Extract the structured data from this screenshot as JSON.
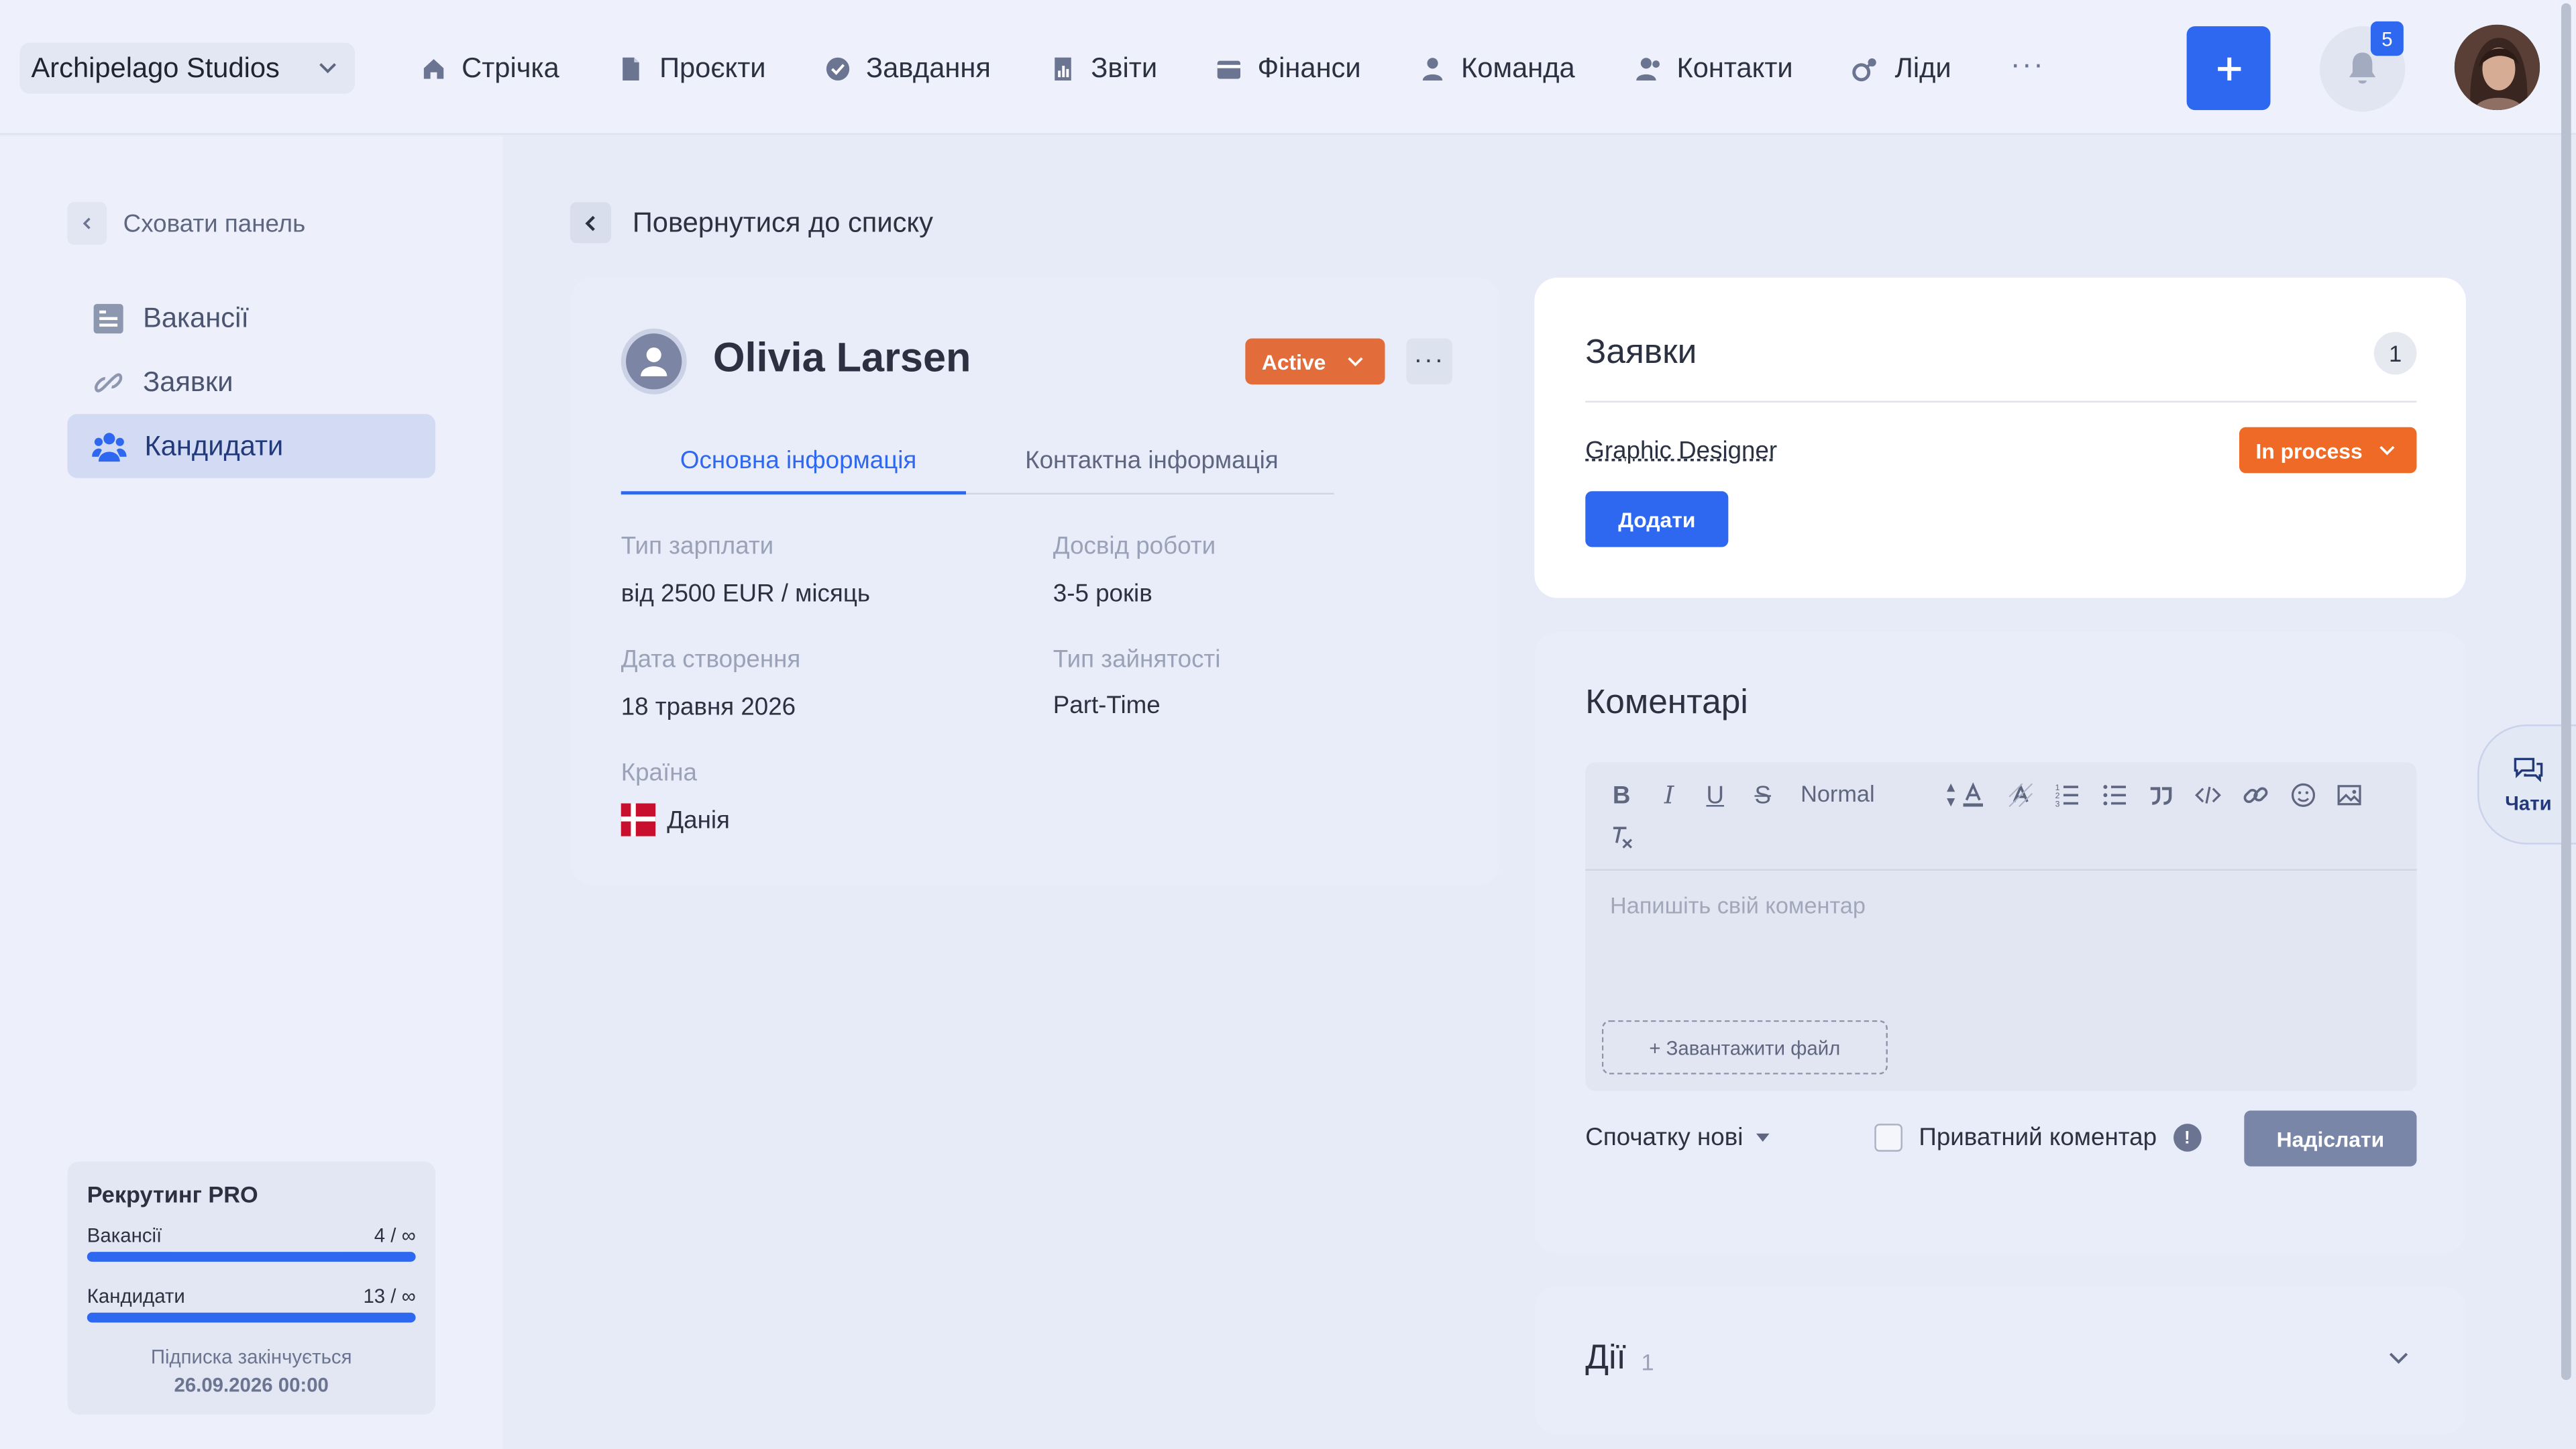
{
  "header": {
    "company": "Archipelago Studios",
    "nav": [
      {
        "label": "Стрічка",
        "icon": "home-icon"
      },
      {
        "label": "Проєкти",
        "icon": "document-icon"
      },
      {
        "label": "Завдання",
        "icon": "check-circle-icon"
      },
      {
        "label": "Звіти",
        "icon": "report-icon"
      },
      {
        "label": "Фінанси",
        "icon": "wallet-icon"
      },
      {
        "label": "Команда",
        "icon": "user-icon"
      },
      {
        "label": "Контакти",
        "icon": "contacts-icon"
      },
      {
        "label": "Ліди",
        "icon": "leads-icon"
      }
    ],
    "more": "···",
    "notifications": "5",
    "accent": "#2f68f0"
  },
  "sidebar": {
    "hide_label": "Сховати панель",
    "items": [
      {
        "label": "Вакансії",
        "icon": "list-icon",
        "active": false
      },
      {
        "label": "Заявки",
        "icon": "link-icon",
        "active": false
      },
      {
        "label": "Кандидати",
        "icon": "people-icon",
        "active": true
      }
    ],
    "plan": {
      "title": "Рекрутинг PRO",
      "rows": [
        {
          "label": "Вакансії",
          "value": "4 / ∞"
        },
        {
          "label": "Кандидати",
          "value": "13 / ∞"
        }
      ],
      "note": "Підписка закінчується",
      "expires": "26.09.2026 00:00"
    }
  },
  "main": {
    "back_label": "Повернутися до списку",
    "profile": {
      "name": "Olivia Larsen",
      "status": "Active",
      "status_color": "#e36c3b",
      "more": "···",
      "tabs": [
        "Основна інформація",
        "Контактна інформація"
      ],
      "active_tab": 0,
      "fields": {
        "salary_label": "Тип зарплати",
        "salary_value": "від 2500 EUR / місяць",
        "experience_label": "Досвід роботи",
        "experience_value": "3-5 років",
        "created_label": "Дата створення",
        "created_value": "18 травня 2026",
        "employment_label": "Тип зайнятості",
        "employment_value": "Part-Time",
        "country_label": "Країна",
        "country_value": "Данія"
      }
    },
    "applications": {
      "title": "Заявки",
      "count": "1",
      "job": "Graphic Designer",
      "job_status": "In process",
      "job_status_color": "#ef6a27",
      "add_label": "Додати"
    },
    "comments": {
      "title": "Коментарі",
      "format_label": "Normal",
      "placeholder": "Напишіть свій коментар",
      "upload_label": "+ Завантажити файл",
      "sort_label": "Спочатку нові",
      "private_label": "Приватний коментар",
      "info_mark": "!",
      "send_label": "Надіслати"
    },
    "actions": {
      "title": "Дії",
      "count": "1"
    }
  },
  "chat": {
    "label": "Чати"
  }
}
